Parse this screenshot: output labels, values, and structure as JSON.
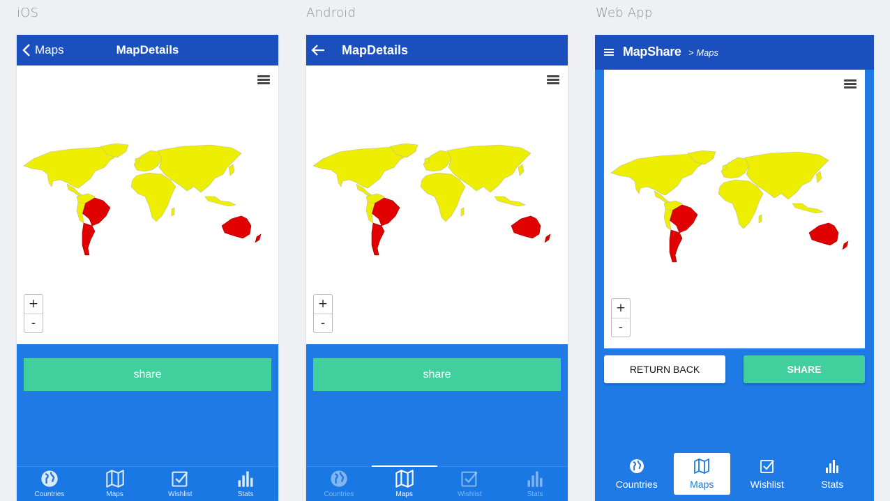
{
  "labels": {
    "ios": "iOS",
    "android": "Android",
    "web": "Web App"
  },
  "ios": {
    "back_label": "Maps",
    "title": "MapDetails",
    "share_label": "share",
    "tabs": [
      {
        "label": "Countries",
        "icon": "globe-icon"
      },
      {
        "label": "Maps",
        "icon": "map-icon"
      },
      {
        "label": "Wishlist",
        "icon": "checkbox-icon"
      },
      {
        "label": "Stats",
        "icon": "bar-chart-icon"
      }
    ]
  },
  "android": {
    "title": "MapDetails",
    "share_label": "share",
    "tabs": [
      {
        "label": "Countries",
        "icon": "globe-icon"
      },
      {
        "label": "Maps",
        "icon": "map-icon"
      },
      {
        "label": "Wishlist",
        "icon": "checkbox-icon"
      },
      {
        "label": "Stats",
        "icon": "bar-chart-icon"
      }
    ]
  },
  "web": {
    "brand": "MapShare",
    "breadcrumb": "> Maps",
    "return_label": "RETURN BACK",
    "share_label": "SHARE",
    "tabs": [
      {
        "label": "Countries",
        "icon": "globe-icon"
      },
      {
        "label": "Maps",
        "icon": "map-icon"
      },
      {
        "label": "Wishlist",
        "icon": "checkbox-icon"
      },
      {
        "label": "Stats",
        "icon": "bar-chart-icon"
      }
    ]
  },
  "map": {
    "zoom_in": "+",
    "zoom_out": "-"
  },
  "colors": {
    "header": "#1a4fbd",
    "background": "#1f7ae6",
    "share": "#41cf9e",
    "land": "#eeee00",
    "visited": "#e00000"
  }
}
